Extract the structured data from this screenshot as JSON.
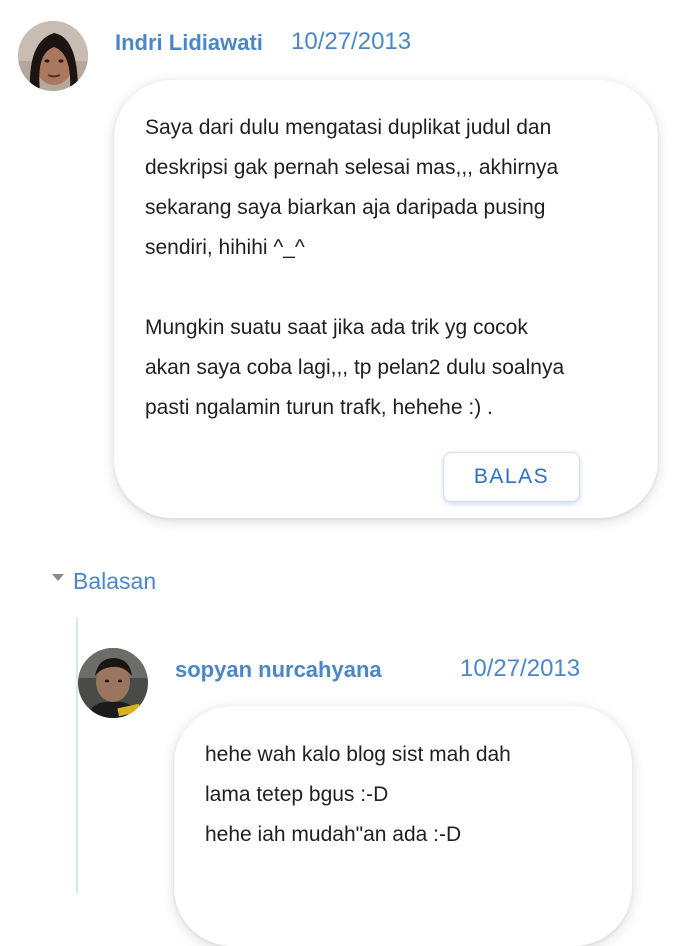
{
  "comments": [
    {
      "author": "Indri Lidiawati",
      "date": "10/27/2013",
      "body": "Saya dari dulu mengatasi duplikat judul dan\ndeskripsi gak pernah selesai mas,,, akhirnya\nsekarang saya biarkan aja daripada pusing\nsendiri, hihihi ^_^\n\nMungkin suatu saat jika ada trik yg cocok\nakan saya coba lagi,,, tp pelan2 dulu soalnya\npasti ngalamin turun trafk, hehehe :) .",
      "reply_label": "BALAS"
    }
  ],
  "replies_toggle": {
    "label": "Balasan"
  },
  "replies": [
    {
      "author": "sopyan nurcahyana",
      "date": "10/27/2013",
      "body": "hehe wah kalo blog sist mah dah\nlama tetep bgus :-D\nhehe iah mudah\"an ada :-D"
    }
  ],
  "colors": {
    "accent": "#4a86c8",
    "button_text": "#2f6fc4",
    "text": "#1f1f1f",
    "thread_line": "#d6ebe4"
  }
}
